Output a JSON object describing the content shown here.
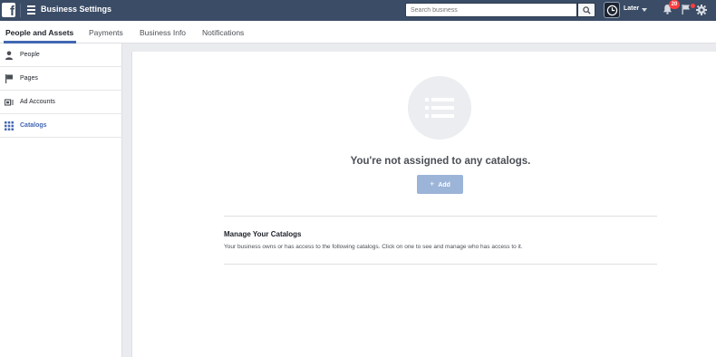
{
  "header": {
    "logo": "f",
    "title": "Business Settings",
    "search_placeholder": "Search business",
    "account_name": "Later",
    "notification_count": "20"
  },
  "tabs": [
    {
      "label": "People and Assets",
      "active": true
    },
    {
      "label": "Payments",
      "active": false
    },
    {
      "label": "Business Info",
      "active": false
    },
    {
      "label": "Notifications",
      "active": false
    }
  ],
  "sidebar": {
    "items": [
      {
        "label": "People",
        "icon": "person-icon",
        "active": false
      },
      {
        "label": "Pages",
        "icon": "flag-icon",
        "active": false
      },
      {
        "label": "Ad Accounts",
        "icon": "ad-account-icon",
        "active": false
      },
      {
        "label": "Catalogs",
        "icon": "grid-icon",
        "active": true
      }
    ]
  },
  "main": {
    "empty_title": "You're not assigned to any catalogs.",
    "add_label": "Add",
    "manage_title": "Manage Your Catalogs",
    "manage_desc": "Your business owns or has access to the following catalogs. Click on one to see and manage who has access to it."
  },
  "colors": {
    "topbar": "#3b4c66",
    "accent": "#4267b2",
    "add_button": "#9cb4d8",
    "badge": "#fa3e3e"
  }
}
